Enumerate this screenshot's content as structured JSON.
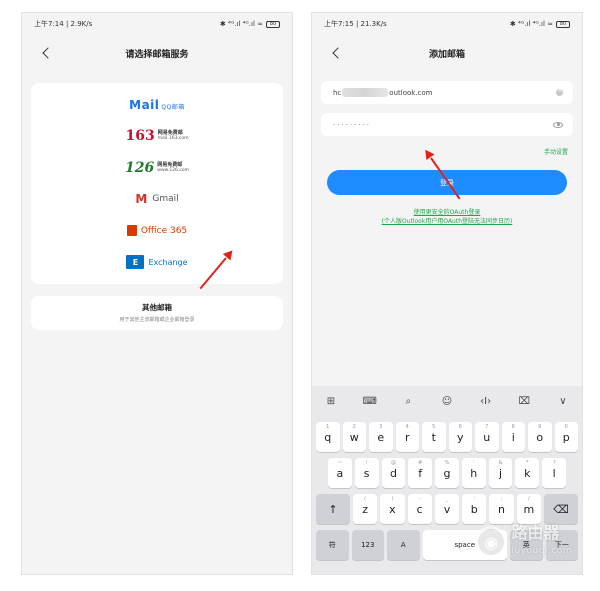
{
  "left": {
    "status": {
      "time": "上午7:14 | 2.9K/s",
      "signal": "✱ ⁴ᴳ.ıl ⁴ᴳ.ıl ≈",
      "battery": "80"
    },
    "title": "请选择邮箱服务",
    "providers": {
      "qq": {
        "brand": "Mail",
        "sub": "QQ邮箱"
      },
      "n163": {
        "brand": "163",
        "sub_title": "网易免费邮",
        "sub_domain": "mail.163.com"
      },
      "n126": {
        "brand": "126",
        "sub_title": "网易免费邮",
        "sub_domain": "www.126.com"
      },
      "gmail": {
        "label": "Gmail"
      },
      "office": {
        "label": "Office 365"
      },
      "exchange": {
        "label": "Exchange"
      }
    },
    "other": {
      "title": "其他邮箱",
      "subtitle": "用于其他主流邮箱或企业邮箱登录"
    }
  },
  "right": {
    "status": {
      "time": "上午7:15 | 21.3K/s",
      "signal": "✱ ⁴ᴳ.ıl ⁴ᴳ.ıl ≈",
      "battery": "80"
    },
    "title": "添加邮箱",
    "email": {
      "prefix": "hc",
      "suffix": "outlook.com"
    },
    "password": {
      "masked": "·········"
    },
    "manual_setup": "手动设置",
    "login_label": "登录",
    "oauth_link": "使用更安全的OAuth登录",
    "oauth_note": "(个人版Outlook用户用OAuth登陆无法同步日历)",
    "keyboard": {
      "toolbar": [
        "⊞",
        "⌨",
        "⌕",
        "☺",
        "‹I›",
        "⌧",
        "∨"
      ],
      "row1": [
        [
          "q",
          "1"
        ],
        [
          "w",
          "2"
        ],
        [
          "e",
          "3"
        ],
        [
          "r",
          "4"
        ],
        [
          "t",
          "5"
        ],
        [
          "y",
          "6"
        ],
        [
          "u",
          "7"
        ],
        [
          "i",
          "8"
        ],
        [
          "o",
          "9"
        ],
        [
          "p",
          "0"
        ]
      ],
      "row2": [
        [
          "a",
          "~"
        ],
        [
          "s",
          "!"
        ],
        [
          "d",
          "@"
        ],
        [
          "f",
          "#"
        ],
        [
          "g",
          "%"
        ],
        [
          "h",
          "'"
        ],
        [
          "j",
          "&"
        ],
        [
          "k",
          "*"
        ],
        [
          "l",
          "?"
        ]
      ],
      "row3": [
        [
          "z",
          "("
        ],
        [
          "x",
          ")"
        ],
        [
          "c",
          "-"
        ],
        [
          "v",
          "_"
        ],
        [
          "b",
          ":"
        ],
        [
          "n",
          ";"
        ],
        [
          "m",
          "/"
        ]
      ],
      "shift": "↑",
      "backspace": "⌫",
      "fu": "符",
      "num": "123",
      "lang": "A",
      "space": "space",
      "key_zh": "英",
      "enter": "下一"
    }
  },
  "watermark": {
    "text": "路由器",
    "sub": "luyouqi.com"
  },
  "colors": {
    "accent_blue": "#1e8cff",
    "link_green": "#1fa64a",
    "arrow_red": "#e0231c"
  }
}
